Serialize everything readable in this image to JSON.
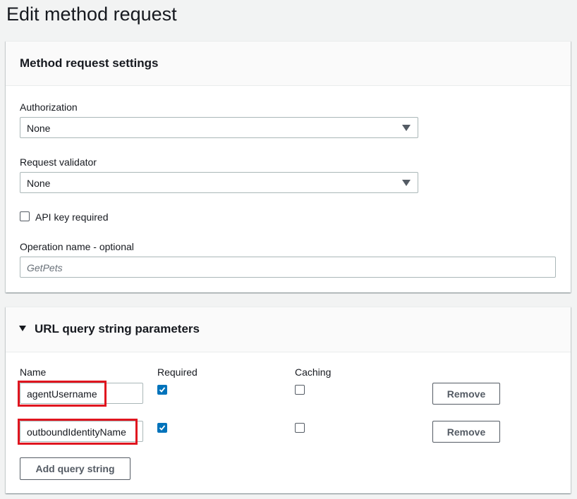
{
  "page": {
    "title": "Edit method request"
  },
  "method_settings": {
    "header": "Method request settings",
    "authorization": {
      "label": "Authorization",
      "value": "None"
    },
    "request_validator": {
      "label": "Request validator",
      "value": "None"
    },
    "api_key_required": {
      "label": "API key required",
      "checked": false
    },
    "operation_name": {
      "label": "Operation name - optional",
      "placeholder": "GetPets",
      "value": ""
    }
  },
  "query_params": {
    "header": "URL query string parameters",
    "expanded": true,
    "columns": {
      "name": "Name",
      "required": "Required",
      "caching": "Caching"
    },
    "rows": [
      {
        "name": "agentUsername",
        "required": true,
        "caching": false,
        "remove_label": "Remove"
      },
      {
        "name": "outboundIdentityName",
        "required": true,
        "caching": false,
        "remove_label": "Remove"
      }
    ],
    "add_label": "Add query string"
  },
  "colors": {
    "accent": "#0073bb",
    "highlight": "#e0151f",
    "background": "#f2f3f3"
  },
  "icons": {
    "dropdown": "caret-down-icon",
    "expand": "triangle-down-icon",
    "checkmark": "checkmark-icon"
  }
}
